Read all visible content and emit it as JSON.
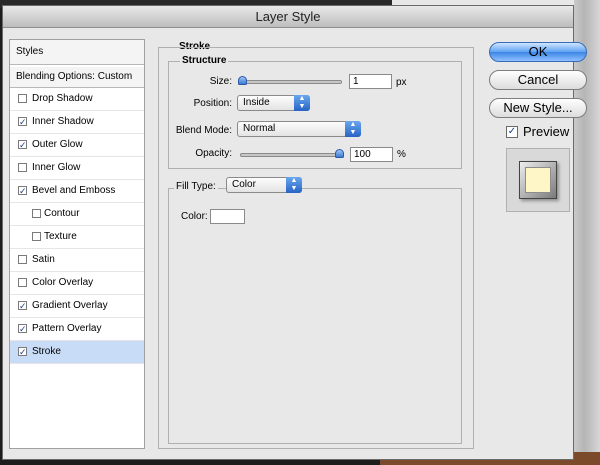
{
  "window": {
    "title": "Layer Style"
  },
  "styles_panel": {
    "header": "Styles",
    "blending_options": "Blending Options: Custom",
    "items": [
      {
        "label": "Drop Shadow",
        "checked": false,
        "indent": false
      },
      {
        "label": "Inner Shadow",
        "checked": true,
        "indent": false
      },
      {
        "label": "Outer Glow",
        "checked": true,
        "indent": false
      },
      {
        "label": "Inner Glow",
        "checked": false,
        "indent": false
      },
      {
        "label": "Bevel and Emboss",
        "checked": true,
        "indent": false
      },
      {
        "label": "Contour",
        "checked": false,
        "indent": true
      },
      {
        "label": "Texture",
        "checked": false,
        "indent": true
      },
      {
        "label": "Satin",
        "checked": false,
        "indent": false
      },
      {
        "label": "Color Overlay",
        "checked": false,
        "indent": false
      },
      {
        "label": "Gradient Overlay",
        "checked": true,
        "indent": false
      },
      {
        "label": "Pattern Overlay",
        "checked": true,
        "indent": false
      },
      {
        "label": "Stroke",
        "checked": true,
        "indent": false,
        "selected": true
      }
    ]
  },
  "stroke": {
    "title": "Stroke",
    "structure": {
      "title": "Structure",
      "size_label": "Size:",
      "size_value": "1",
      "size_unit": "px",
      "size_slider_fraction": 0.0,
      "position_label": "Position:",
      "position_value": "Inside",
      "blend_mode_label": "Blend Mode:",
      "blend_mode_value": "Normal",
      "opacity_label": "Opacity:",
      "opacity_value": "100",
      "opacity_unit": "%",
      "opacity_slider_fraction": 1.0
    },
    "fill": {
      "fill_type_label": "Fill Type:",
      "fill_type_value": "Color",
      "color_label": "Color:",
      "color_value": "#ffffff"
    }
  },
  "buttons": {
    "ok": "OK",
    "cancel": "Cancel",
    "new_style": "New Style..."
  },
  "preview": {
    "label": "Preview",
    "checked": true
  },
  "colors": {
    "selection": "#c8dcf7",
    "accent": "#3c86e6",
    "preview_fill": "#fff6c8"
  }
}
